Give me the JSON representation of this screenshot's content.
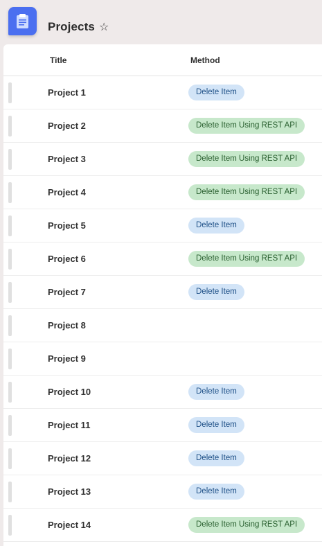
{
  "header": {
    "title": "Projects"
  },
  "icons": {
    "app": "clipboard-icon",
    "favorite": "star-icon"
  },
  "columns": {
    "title": "Title",
    "method": "Method"
  },
  "colors": {
    "delete_item": "#d2e4f7",
    "delete_item_rest": "#c7e8cb",
    "accent": "#4b6ff0"
  },
  "rows": [
    {
      "title": "Project 1",
      "method": "Delete Item",
      "method_color": "blue"
    },
    {
      "title": "Project 2",
      "method": "Delete Item Using REST API",
      "method_color": "green"
    },
    {
      "title": "Project 3",
      "method": "Delete Item Using REST API",
      "method_color": "green"
    },
    {
      "title": "Project 4",
      "method": "Delete Item Using REST API",
      "method_color": "green"
    },
    {
      "title": "Project 5",
      "method": "Delete Item",
      "method_color": "blue"
    },
    {
      "title": "Project 6",
      "method": "Delete Item Using REST API",
      "method_color": "green"
    },
    {
      "title": "Project 7",
      "method": "Delete Item",
      "method_color": "blue"
    },
    {
      "title": "Project 8",
      "method": "",
      "method_color": "none"
    },
    {
      "title": "Project 9",
      "method": "",
      "method_color": "none"
    },
    {
      "title": "Project 10",
      "method": "Delete Item",
      "method_color": "blue"
    },
    {
      "title": "Project 11",
      "method": "Delete Item",
      "method_color": "blue"
    },
    {
      "title": "Project 12",
      "method": "Delete Item",
      "method_color": "blue"
    },
    {
      "title": "Project 13",
      "method": "Delete Item",
      "method_color": "blue"
    },
    {
      "title": "Project 14",
      "method": "Delete Item Using REST API",
      "method_color": "green"
    }
  ]
}
